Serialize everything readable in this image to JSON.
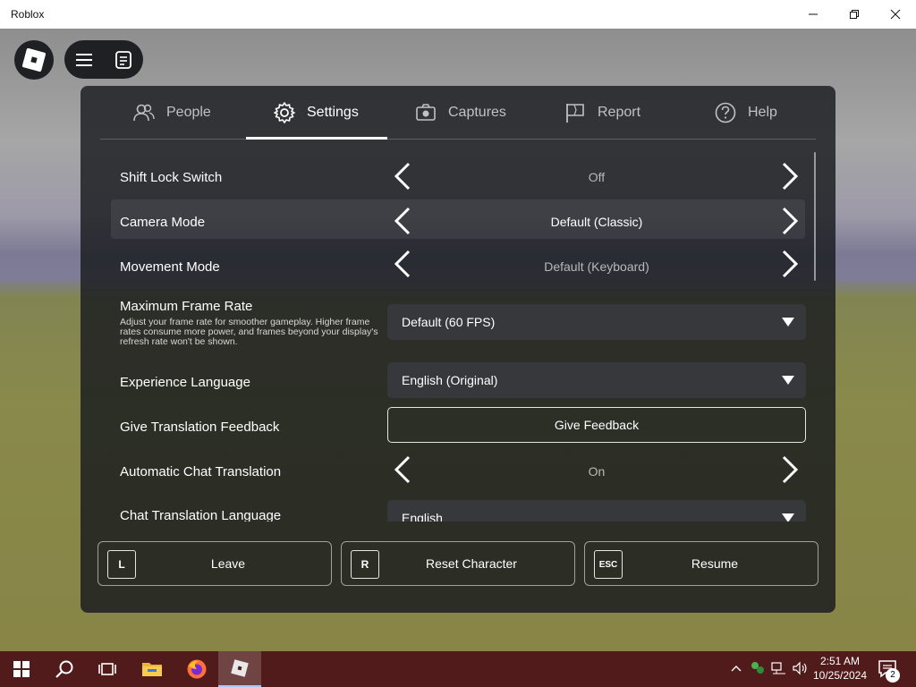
{
  "window": {
    "title": "Roblox"
  },
  "tabs": [
    {
      "label": "People",
      "icon": "people-icon"
    },
    {
      "label": "Settings",
      "icon": "gear-icon"
    },
    {
      "label": "Captures",
      "icon": "camera-icon"
    },
    {
      "label": "Report",
      "icon": "flag-icon"
    },
    {
      "label": "Help",
      "icon": "help-icon"
    }
  ],
  "settings": {
    "shift_lock": {
      "label": "Shift Lock Switch",
      "value": "Off"
    },
    "camera_mode": {
      "label": "Camera Mode",
      "value": "Default (Classic)"
    },
    "movement_mode": {
      "label": "Movement Mode",
      "value": "Default (Keyboard)"
    },
    "max_frame_rate": {
      "label": "Maximum Frame Rate",
      "description": "Adjust your frame rate for smoother gameplay. Higher frame rates consume more power, and frames beyond your display's refresh rate won't be shown.",
      "value": "Default (60 FPS)"
    },
    "experience_language": {
      "label": "Experience Language",
      "value": "English (Original)"
    },
    "translation_feedback": {
      "label": "Give Translation Feedback",
      "button": "Give Feedback"
    },
    "auto_chat_translation": {
      "label": "Automatic Chat Translation",
      "value": "On"
    },
    "chat_translation_language": {
      "label": "Chat Translation Language",
      "value": "English"
    }
  },
  "actions": [
    {
      "key": "L",
      "label": "Leave"
    },
    {
      "key": "R",
      "label": "Reset Character"
    },
    {
      "key": "ESC",
      "label": "Resume"
    }
  ],
  "taskbar": {
    "time": "2:51 AM",
    "date": "10/25/2024",
    "notification_count": "2"
  },
  "colors": {
    "panel_bg": "#191b1e",
    "taskbar_bg": "#521b1b",
    "text": "#ffffff"
  }
}
